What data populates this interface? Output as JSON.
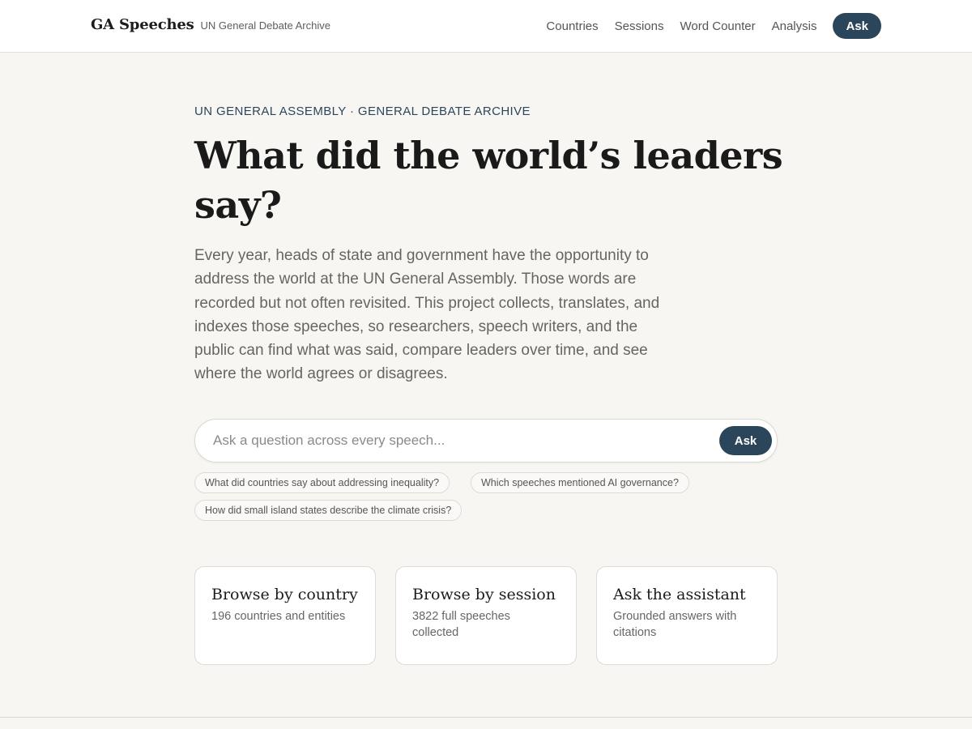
{
  "header": {
    "brand_name": "GA Speeches",
    "brand_subtitle": "UN General Debate Archive",
    "nav": [
      {
        "label": "Countries"
      },
      {
        "label": "Sessions"
      },
      {
        "label": "Word Counter"
      },
      {
        "label": "Analysis"
      }
    ],
    "ask_label": "Ask"
  },
  "hero": {
    "eyebrow": "UN GENERAL ASSEMBLY · GENERAL DEBATE ARCHIVE",
    "title": "What did the world’s leaders say?",
    "description": "Every year, heads of state and government have the opportunity to address the world at the UN General Assembly. Those words are recorded but not often revisited. This project collects, translates, and indexes those speeches, so researchers, speech writers, and the public can find what was said, compare leaders over time, and see where the world agrees or disagrees."
  },
  "search": {
    "placeholder": "Ask a question across every speech...",
    "value": "",
    "button_label": "Ask",
    "suggestions": [
      {
        "label": "What did countries say about addressing inequality?"
      },
      {
        "label": "Which speeches mentioned AI governance?"
      },
      {
        "label": "How did small island states describe the climate crisis?"
      }
    ]
  },
  "cards": [
    {
      "title": "Browse by country",
      "description": "196 countries and entities"
    },
    {
      "title": "Browse by session",
      "description": "3822 full speeches collected"
    },
    {
      "title": "Ask the assistant",
      "description": "Grounded answers with citations"
    }
  ],
  "colors": {
    "page_background": "#f8f6f3",
    "accent": "#2b465a",
    "card_border": "#dedad4"
  }
}
